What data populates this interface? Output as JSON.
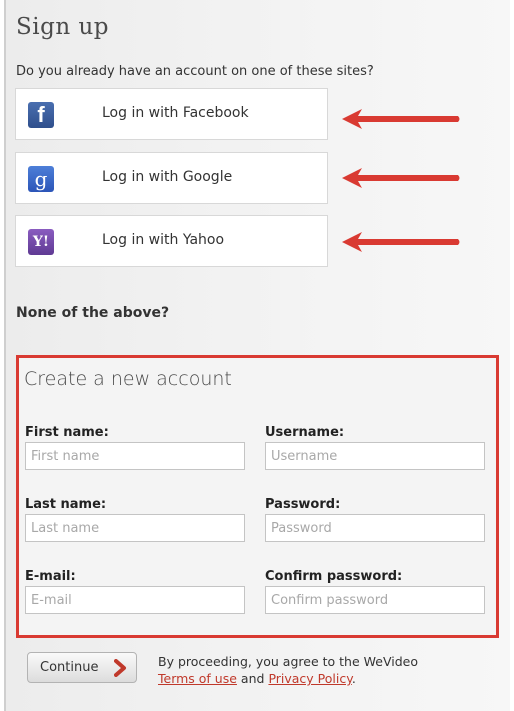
{
  "title": "Sign up",
  "question": "Do you already have an account on one of these sites?",
  "social": [
    {
      "label": "Log in with Facebook",
      "icon": "facebook-icon",
      "glyph": "f",
      "color": "#3b5998"
    },
    {
      "label": "Log in with Google",
      "icon": "google-icon",
      "glyph": "g",
      "color": "#3b6fd0"
    },
    {
      "label": "Log in with Yahoo",
      "icon": "yahoo-icon",
      "glyph": "Y!",
      "color": "#7b4bb0"
    }
  ],
  "none_above": "None of the above?",
  "create": {
    "title": "Create a new account",
    "fields": [
      {
        "label": "First name:",
        "placeholder": "First name"
      },
      {
        "label": "Username:",
        "placeholder": "Username"
      },
      {
        "label": "Last name:",
        "placeholder": "Last name"
      },
      {
        "label": "Password:",
        "placeholder": "Password"
      },
      {
        "label": "E-mail:",
        "placeholder": "E-mail"
      },
      {
        "label": "Confirm password:",
        "placeholder": "Confirm password"
      }
    ]
  },
  "continue_label": "Continue",
  "terms": {
    "line1": "By proceeding, you agree to the WeVideo",
    "terms_link": "Terms of use",
    "and": "and",
    "privacy_link": "Privacy Policy",
    "period": "."
  },
  "colors": {
    "highlight": "#d93a32",
    "arrow": "#d93a32",
    "link": "#c0392b"
  }
}
